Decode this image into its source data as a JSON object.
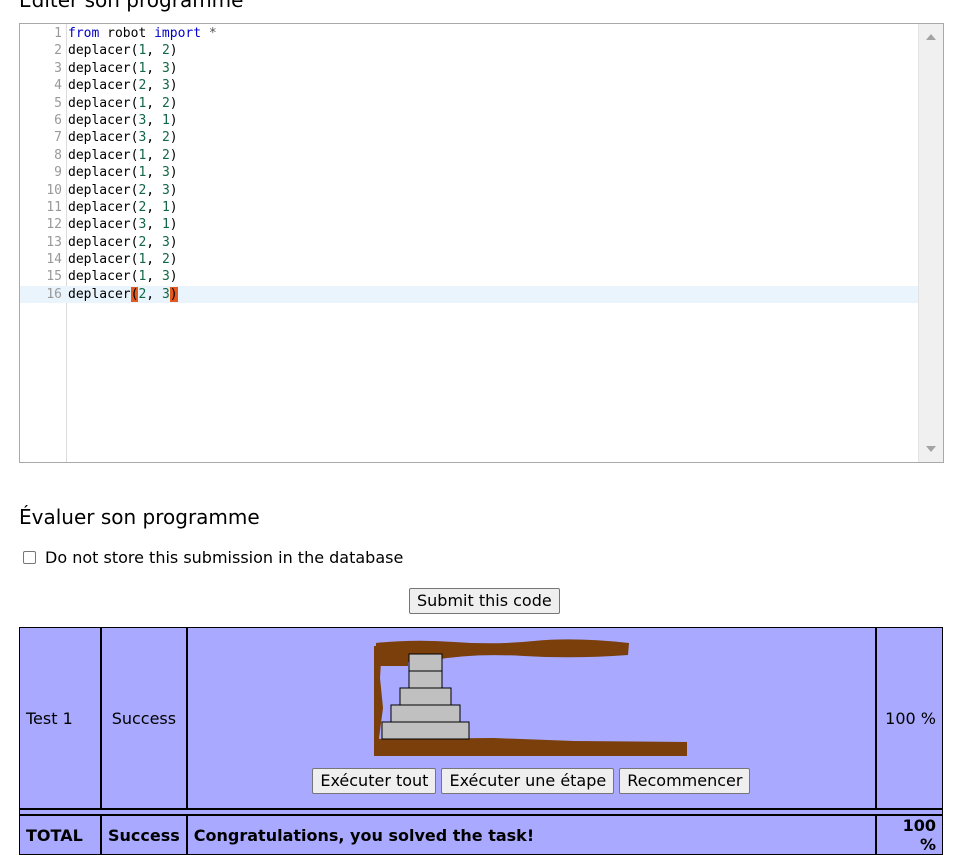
{
  "editor_heading": "Éditer son programme",
  "code_lines": [
    {
      "n": "1",
      "text": "from robot import *"
    },
    {
      "n": "2",
      "text": "deplacer(1, 2)"
    },
    {
      "n": "3",
      "text": "deplacer(1, 3)"
    },
    {
      "n": "4",
      "text": "deplacer(2, 3)"
    },
    {
      "n": "5",
      "text": "deplacer(1, 2)"
    },
    {
      "n": "6",
      "text": "deplacer(3, 1)"
    },
    {
      "n": "7",
      "text": "deplacer(3, 2)"
    },
    {
      "n": "8",
      "text": "deplacer(1, 2)"
    },
    {
      "n": "9",
      "text": "deplacer(1, 3)"
    },
    {
      "n": "10",
      "text": "deplacer(2, 3)"
    },
    {
      "n": "11",
      "text": "deplacer(2, 1)"
    },
    {
      "n": "12",
      "text": "deplacer(3, 1)"
    },
    {
      "n": "13",
      "text": "deplacer(2, 3)"
    },
    {
      "n": "14",
      "text": "deplacer(1, 2)"
    },
    {
      "n": "15",
      "text": "deplacer(1, 3)"
    },
    {
      "n": "16",
      "text": "deplacer(2, 3)"
    }
  ],
  "evaluate": {
    "heading": "Évaluer son programme",
    "no_store_label": "Do not store this submission in the database",
    "submit_label": "Submit this code"
  },
  "results": {
    "test": {
      "name": "Test 1",
      "status": "Success",
      "score": "100 %"
    },
    "controls": {
      "run_all": "Exécuter tout",
      "step": "Exécuter une étape",
      "restart": "Recommencer"
    },
    "total": {
      "label": "TOTAL",
      "status": "Success",
      "message": "Congratulations, you solved the task!",
      "score": "100 %"
    }
  },
  "colors": {
    "result_bg": "#a9a9ff",
    "frame_brown": "#7a3f0a",
    "disk_gray": "#c0c0c0",
    "bracket_highlight": "#e3581f",
    "active_line": "#eaf4fc"
  }
}
